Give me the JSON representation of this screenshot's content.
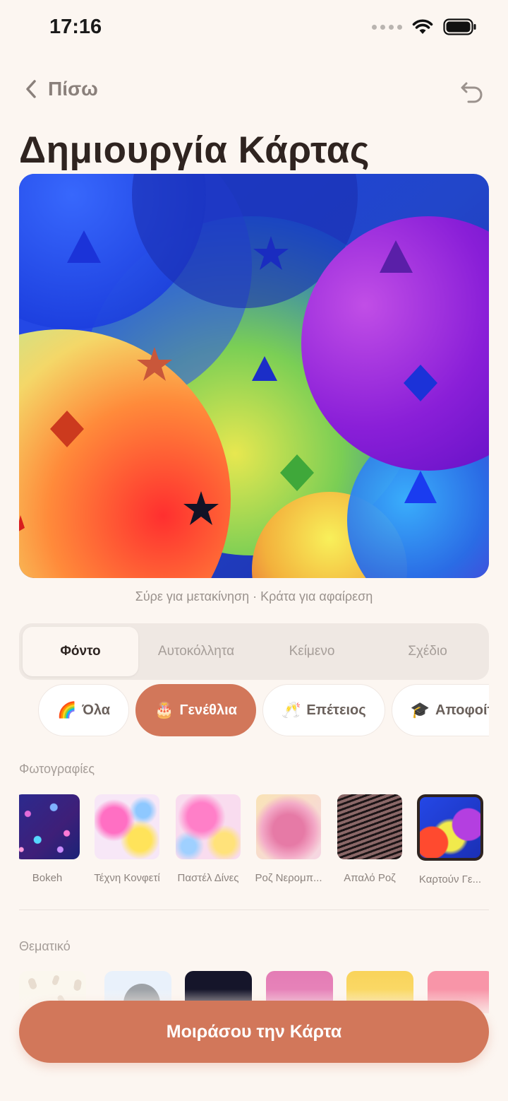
{
  "status_bar": {
    "time": "17:16"
  },
  "nav": {
    "back_label": "Πίσω"
  },
  "page": {
    "title": "Δημιουργία Κάρτας",
    "hint": "Σύρε για μετακίνηση · Κράτα για αφαίρεση"
  },
  "tabs": [
    {
      "label": "Φόντο",
      "active": true
    },
    {
      "label": "Αυτοκόλλητα",
      "active": false
    },
    {
      "label": "Κείμενο",
      "active": false
    },
    {
      "label": "Σχέδιο",
      "active": false
    }
  ],
  "chips": [
    {
      "emoji": "🌈",
      "label": "Όλα",
      "active": false
    },
    {
      "emoji": "🎂",
      "label": "Γενέθλια",
      "active": true
    },
    {
      "emoji": "🥂",
      "label": "Επέτειος",
      "active": false
    },
    {
      "emoji": "🎓",
      "label": "Αποφοίτηση",
      "active": false
    }
  ],
  "photos_section": {
    "label": "Φωτογραφίες",
    "items": [
      {
        "label": "Bokeh",
        "selected": false
      },
      {
        "label": "Τέχνη Κονφετί",
        "selected": false
      },
      {
        "label": "Παστέλ Δίνες",
        "selected": false
      },
      {
        "label": "Ροζ Νερομπ...",
        "selected": false
      },
      {
        "label": "Απαλό Ροζ",
        "selected": false
      },
      {
        "label": "Καρτούν Γε...",
        "selected": true
      }
    ]
  },
  "themes_section": {
    "label": "Θεματικό"
  },
  "share_button": {
    "label": "Μοιράσου την Κάρτα"
  },
  "colors": {
    "accent": "#d2775a",
    "background": "#fcf6f1",
    "text": "#2e2522"
  }
}
